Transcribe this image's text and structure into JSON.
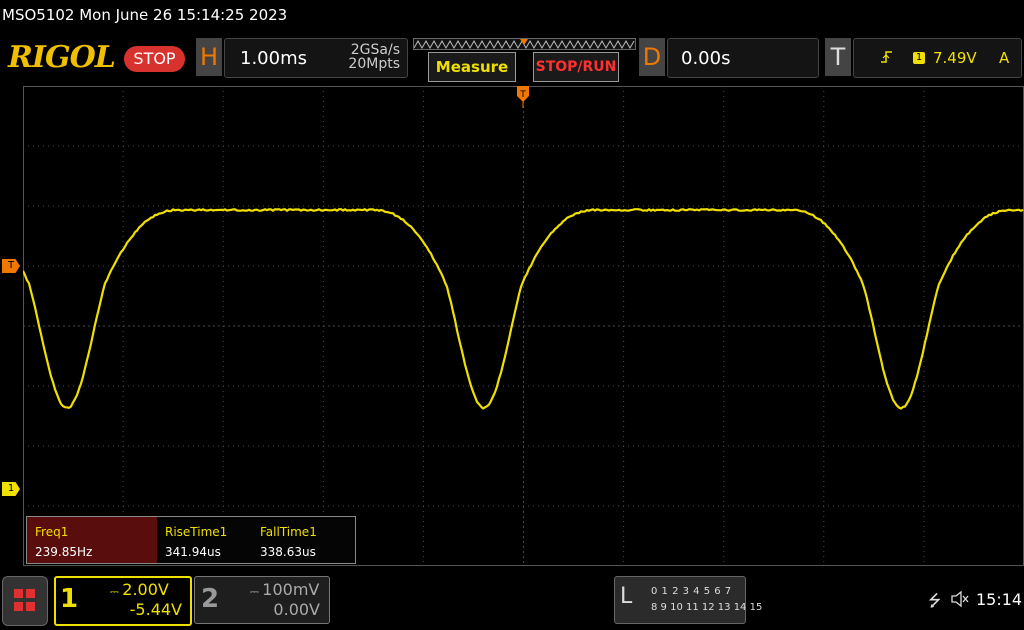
{
  "header": {
    "model_datetime": "MSO5102  Mon June 26 15:14:25 2023",
    "logo": "RIGOL",
    "run_state": "STOP"
  },
  "horizontal": {
    "tab": "H",
    "timebase": "1.00ms",
    "sample_rate": "2GSa/s",
    "memory_depth": "20Mpts"
  },
  "buttons": {
    "measure": "Measure",
    "stop_run": "STOP/RUN"
  },
  "delay": {
    "tab": "D",
    "value": "0.00s"
  },
  "trigger": {
    "tab": "T",
    "slope_icon": "rising-edge-icon",
    "source": "1",
    "level": "7.49V",
    "mode": "A",
    "marker": "T"
  },
  "channel_marker": "1",
  "measurements": [
    {
      "label": "Freq1",
      "value": "239.85Hz"
    },
    {
      "label": "RiseTime1",
      "value": "341.94us"
    },
    {
      "label": "FallTime1",
      "value": "338.63us"
    }
  ],
  "channel1": {
    "number": "1",
    "scale": "2.00V",
    "offset": "-5.44V",
    "color": "#f0e000"
  },
  "channel2": {
    "number": "2",
    "scale": "100mV",
    "offset": "0.00V"
  },
  "logic_analyzer": {
    "label": "L",
    "row1": "0 1 2 3  4 5 6 7",
    "row2": "8 9 10 11 12 13 14 15"
  },
  "status": {
    "usb_icon": "usb-icon",
    "sound_icon": "mute-icon",
    "time": "15:14"
  },
  "colors": {
    "trace": "#f0e000",
    "accent": "#f07800",
    "stop": "#d8322f"
  }
}
